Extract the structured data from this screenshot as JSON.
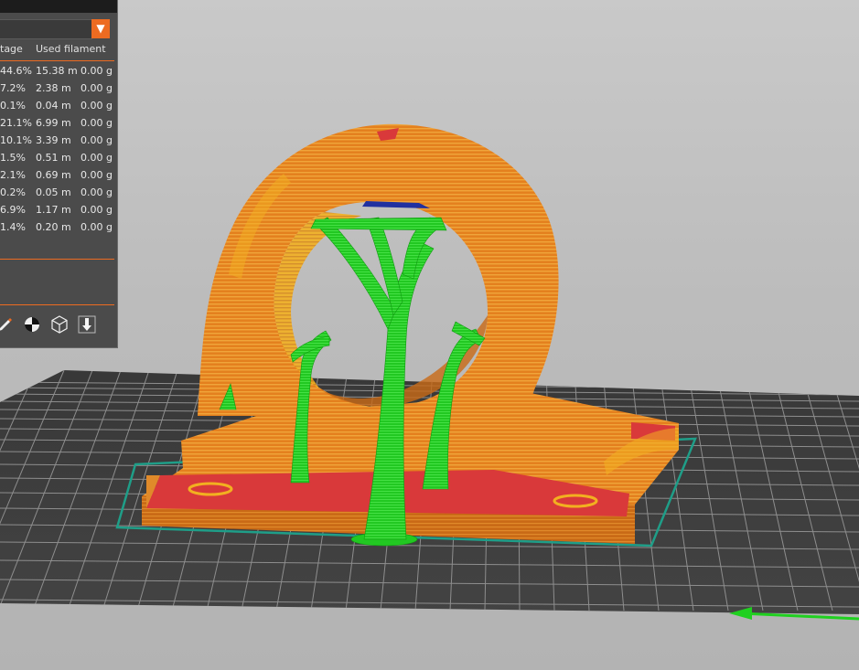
{
  "legend": {
    "header": {
      "percentage": "tage",
      "used_filament": "Used filament"
    },
    "rows": [
      {
        "percentage": "44.6%",
        "length": "15.38 m",
        "weight": "0.00 g"
      },
      {
        "percentage": "7.2%",
        "length": "2.38 m",
        "weight": "0.00 g"
      },
      {
        "percentage": "0.1%",
        "length": "0.04 m",
        "weight": "0.00 g"
      },
      {
        "percentage": "21.1%",
        "length": "6.99 m",
        "weight": "0.00 g"
      },
      {
        "percentage": "10.1%",
        "length": "3.39 m",
        "weight": "0.00 g"
      },
      {
        "percentage": "1.5%",
        "length": "0.51 m",
        "weight": "0.00 g"
      },
      {
        "percentage": "2.1%",
        "length": "0.69 m",
        "weight": "0.00 g"
      },
      {
        "percentage": "0.2%",
        "length": "0.05 m",
        "weight": "0.00 g"
      },
      {
        "percentage": "6.9%",
        "length": "1.17 m",
        "weight": "0.00 g"
      },
      {
        "percentage": "1.4%",
        "length": "0.20 m",
        "weight": "0.00 g"
      }
    ],
    "dropdown_icon": "triangle-down-icon",
    "tools": [
      "pencil-icon",
      "center-of-mass-icon",
      "wireframe-cube-icon",
      "export-arrow-icon"
    ]
  },
  "colors": {
    "accent": "#ed6b21",
    "panel_bg": "#4b4b4b",
    "outer_wall": "#e4801e",
    "inner_wall": "#f2b020",
    "solid_infill": "#d9393a",
    "support": "#22cc22",
    "skirt": "#1f9e88",
    "bed": "#3b3b3b",
    "bed_grid": "#9a9a9a",
    "axis_y": "#1fd01f"
  }
}
